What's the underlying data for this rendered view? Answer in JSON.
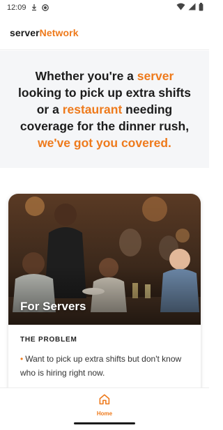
{
  "status_bar": {
    "time": "12:09",
    "icons": [
      "download-icon",
      "record-icon",
      "wifi-icon",
      "cell-signal-icon",
      "battery-icon"
    ]
  },
  "app": {
    "brand_part1": "server",
    "brand_part2": "Network",
    "accent_color": "#ee7a1c"
  },
  "hero": {
    "t1": "Whether you're a ",
    "t2": "server",
    "t3": " looking to pick up extra shifts or a ",
    "t4": "restaurant",
    "t5": " needing coverage for the dinner rush, ",
    "t6": "we've got you covered."
  },
  "card": {
    "title": "For Servers",
    "section_label": "THE PROBLEM",
    "problems": [
      "Want to pick up extra shifts but don't know who is hiring right now."
    ]
  },
  "bottom_nav": {
    "items": [
      {
        "label": "Home",
        "icon": "home-icon",
        "active": true
      }
    ]
  }
}
